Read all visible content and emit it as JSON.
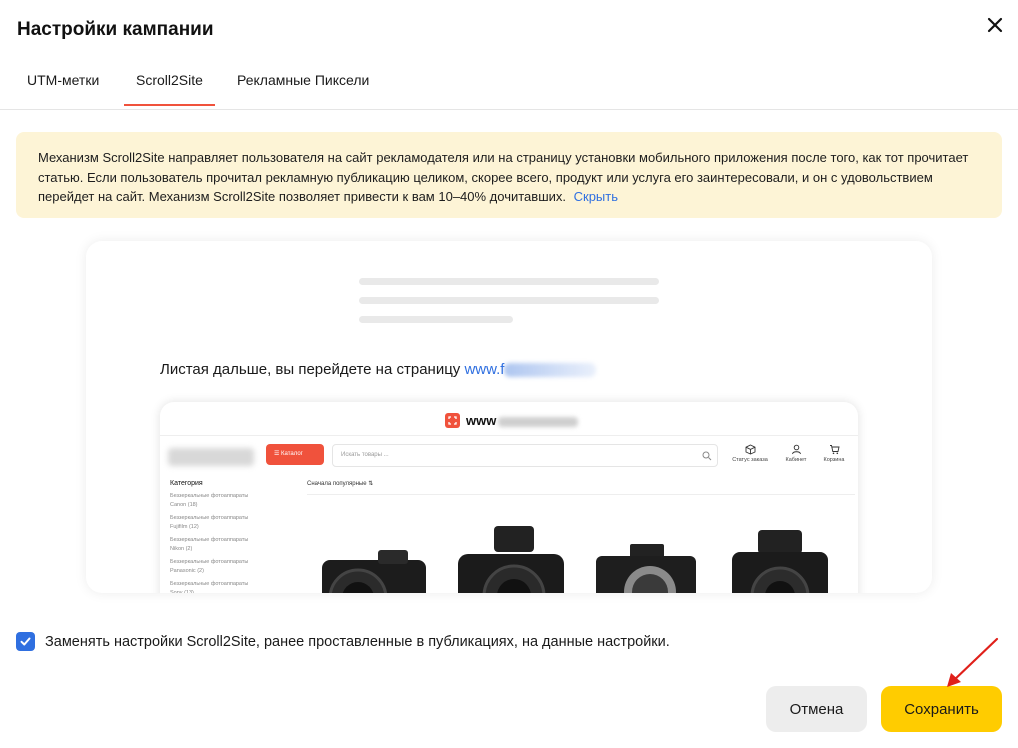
{
  "dialog": {
    "title": "Настройки кампании"
  },
  "tabs": [
    {
      "label": "UTM-метки"
    },
    {
      "label": "Scroll2Site"
    },
    {
      "label": "Рекламные Пиксели"
    }
  ],
  "info": {
    "text": "Механизм Scroll2Site направляет пользователя на сайт рекламодателя или на страницу установки мобильного приложения после того, как тот прочитает статью. Если пользователь прочитал рекламную публикацию целиком, скорее всего, продукт или услуга его заинтересовали, и он с удовольствием перейдет на сайт. Механизм Scroll2Site позволяет привести к вам 10–40% дочитавших.",
    "hide_link": "Скрыть"
  },
  "preview": {
    "redirect_text": "Листая дальше, вы перейдете на страницу ",
    "redirect_url_prefix": "www.f",
    "site_domain_prefix": "www",
    "catalog_button": "Каталог",
    "search_placeholder": "Искать товары ...",
    "actions": [
      "Статус заказа",
      "Кабинет",
      "Корзина"
    ],
    "category_title": "Категория",
    "categories": [
      "Беззеркальные фотоаппараты Canon (18)",
      "Беззеркальные фотоаппараты Fujifilm (12)",
      "Беззеркальные фотоаппараты Nikon (2)",
      "Беззеркальные фотоаппараты Panasonic (2)",
      "Беззеркальные фотоаппараты Sony (13)"
    ],
    "sort_label": "Сначала популярные"
  },
  "checkbox": {
    "checked": true,
    "label": "Заменять настройки Scroll2Site, ранее проставленные в публикациях, на данные настройки."
  },
  "buttons": {
    "cancel": "Отмена",
    "save": "Сохранить"
  },
  "colors": {
    "accent_yellow": "#ffcc00",
    "tab_underline": "#f0523c",
    "link_blue": "#2f6fe0",
    "banner_bg": "#fdf4d6"
  }
}
